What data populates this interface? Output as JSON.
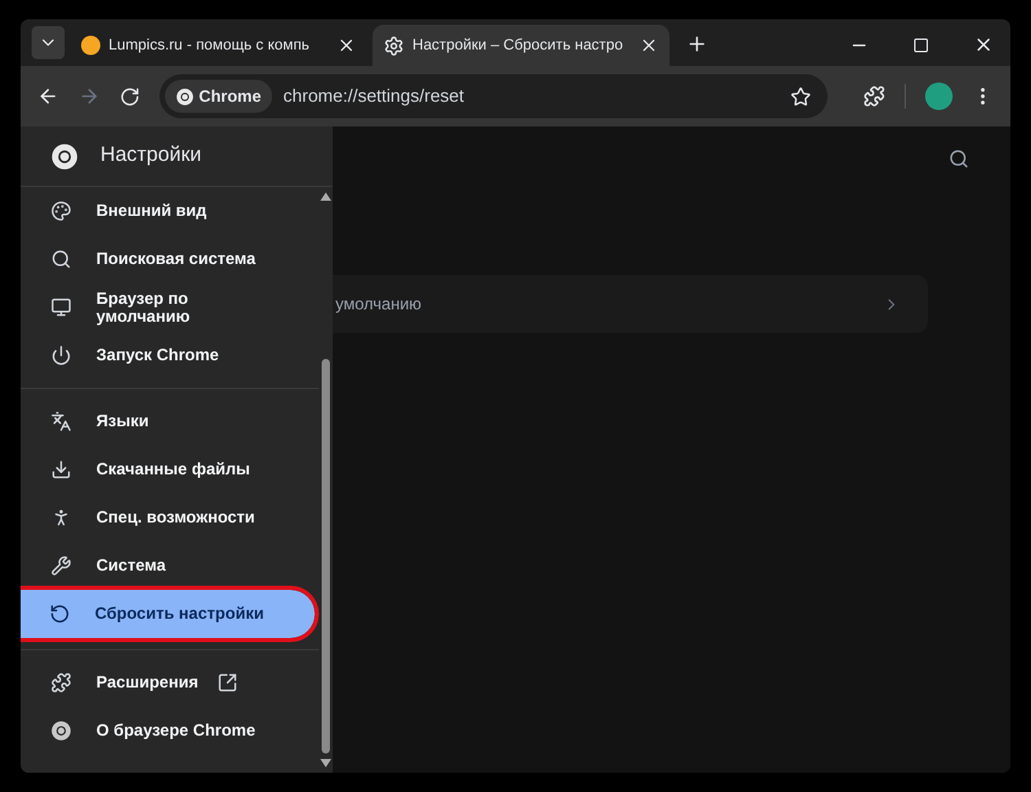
{
  "tabs": [
    {
      "title": "Lumpics.ru - помощь с компь",
      "selected": false
    },
    {
      "title": "Настройки – Сбросить настро",
      "selected": true
    }
  ],
  "address_bar": {
    "chip": "Chrome",
    "url": "chrome://settings/reset"
  },
  "sidebar": {
    "title": "Настройки",
    "groups": [
      [
        {
          "label": "Внешний вид",
          "kind": "page",
          "selected": false
        },
        {
          "label": "Поисковая система",
          "kind": "page",
          "selected": false
        },
        {
          "label": "Браузер по умолчанию",
          "kind": "page",
          "selected": false
        },
        {
          "label": "Запуск Chrome",
          "kind": "page",
          "selected": false
        }
      ],
      [
        {
          "label": "Языки",
          "kind": "page",
          "selected": false
        },
        {
          "label": "Скачанные файлы",
          "kind": "page",
          "selected": false
        },
        {
          "label": "Спец. возможности",
          "kind": "page",
          "selected": false
        },
        {
          "label": "Система",
          "kind": "page",
          "selected": false
        },
        {
          "label": "Сбросить настройки",
          "kind": "page",
          "selected": true
        }
      ],
      [
        {
          "label": "Расширения",
          "kind": "external",
          "selected": false
        },
        {
          "label": "О браузере Chrome",
          "kind": "page",
          "selected": false
        }
      ]
    ]
  },
  "main": {
    "card": {
      "label": "умолчанию"
    }
  }
}
